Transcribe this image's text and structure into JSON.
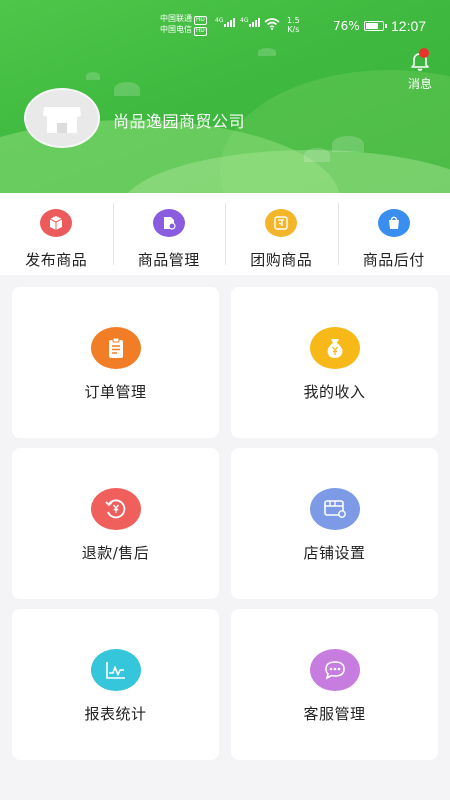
{
  "status_bar": {
    "carrier1": "中国联通",
    "carrier2": "中国电信",
    "hd": "HD",
    "network": "4G",
    "speed_value": "1.5",
    "speed_unit": "K/s",
    "battery": "76%",
    "time": "12:07"
  },
  "header": {
    "message_label": "消息",
    "company_name": "尚品逸园商贸公司"
  },
  "quick_actions": [
    {
      "label": "发布商品",
      "icon": "box-icon",
      "color": "#ec5b5b"
    },
    {
      "label": "商品管理",
      "icon": "product-settings-icon",
      "color": "#8a5ce0"
    },
    {
      "label": "团购商品",
      "icon": "group-buy-icon",
      "color": "#f3b62a"
    },
    {
      "label": "商品后付",
      "icon": "bag-icon",
      "color": "#3a8ef0"
    }
  ],
  "menu": [
    {
      "label": "订单管理",
      "icon": "clipboard-icon",
      "color": "#f27d27"
    },
    {
      "label": "我的收入",
      "icon": "money-bag-icon",
      "color": "#f6b917"
    },
    {
      "label": "退款/售后",
      "icon": "refund-icon",
      "color": "#ef5f5b"
    },
    {
      "label": "店铺设置",
      "icon": "store-settings-icon",
      "color": "#7c9ae6"
    },
    {
      "label": "报表统计",
      "icon": "chart-icon",
      "color": "#35c6dc"
    },
    {
      "label": "客服管理",
      "icon": "chat-icon",
      "color": "#c77ce0"
    }
  ]
}
